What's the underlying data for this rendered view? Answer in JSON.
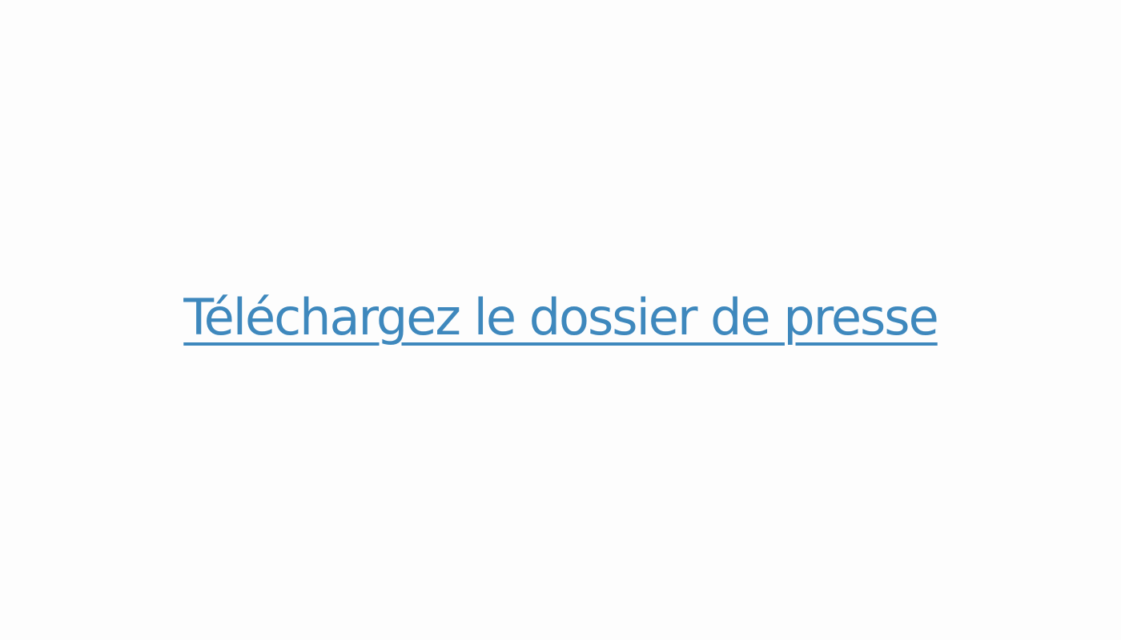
{
  "link": {
    "label": "Téléchargez le dossier de presse"
  },
  "colors": {
    "link": "#3e88bd",
    "background": "#fdfdfd"
  }
}
